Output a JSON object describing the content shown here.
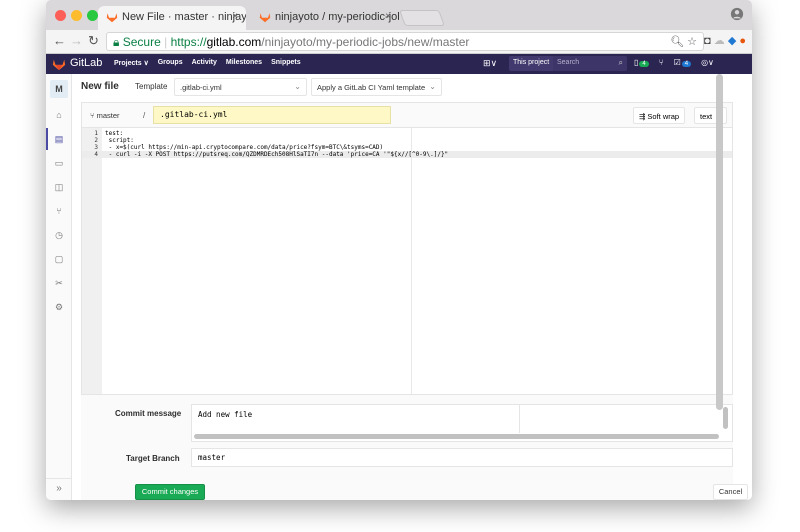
{
  "browser": {
    "tabs": [
      {
        "title": "New File · master · ninjayoto /",
        "close": "×"
      },
      {
        "title": "ninjayoto / my-periodic-jobs ·",
        "close": "×"
      }
    ],
    "secure_label": "Secure",
    "url_scheme": "https://",
    "url_host": "gitlab.com",
    "url_path": "/ninjayoto/my-periodic-jobs/new/master"
  },
  "gitlab": {
    "brand": "GitLab",
    "nav": [
      "Projects ∨",
      "Groups",
      "Activity",
      "Milestones",
      "Snippets"
    ],
    "this_project": "This project",
    "search_placeholder": "Search",
    "todo_count": "4",
    "mr_count": "4",
    "project_initial": "M"
  },
  "editor_page": {
    "title": "New file",
    "template_label": "Template",
    "template_value": ".gitlab-ci.yml",
    "template_action": "Apply a GitLab CI Yaml template",
    "branch": "master",
    "separator": "/",
    "file_name": ".gitlab-ci.yml",
    "soft_wrap": "Soft wrap",
    "mode": "text",
    "lines": [
      {
        "n": "1",
        "text": "test:"
      },
      {
        "n": "2",
        "text": " script:"
      },
      {
        "n": "3",
        "text": " - x=$(curl https://min-api.cryptocompare.com/data/price?fsym=BTC\\&tsyms=CAD)"
      },
      {
        "n": "4",
        "text": " - curl -i -X POST https://putsreq.com/QZDMRDEch508HlSaTI7n --data 'price=CA '\"${x//[^0-9\\.]/}\""
      }
    ]
  },
  "commit_form": {
    "message_label": "Commit message",
    "message_value": "Add new file",
    "branch_label": "Target Branch",
    "branch_value": "master",
    "commit_button": "Commit changes",
    "cancel_button": "Cancel"
  },
  "colors": {
    "header_bg": "#2b2552",
    "commit_green": "#1aaa55",
    "filename_bg": "#fdf8c6"
  }
}
